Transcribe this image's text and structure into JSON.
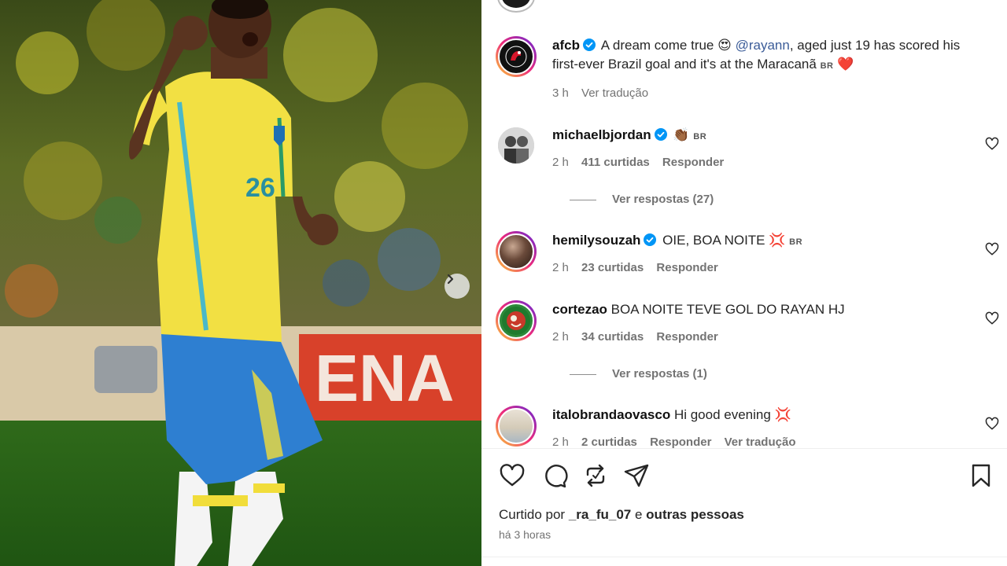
{
  "post": {
    "author": "afcb",
    "caption_intro": "A dream come true",
    "caption_emoji": "😍",
    "mention": "@rayann",
    "caption_rest": ", aged just 19 has scored his first-ever Brazil goal and it's at the Maracanã",
    "flag": "BR",
    "heart": "❤️",
    "age": "3 h",
    "translate": "Ver tradução"
  },
  "comments": [
    {
      "user": "michaelbjordan",
      "verified": true,
      "text": "",
      "emoji": "👏🏾",
      "flag": "BR",
      "age": "2 h",
      "likes": "411 curtidas",
      "reply": "Responder",
      "view_replies": "Ver respostas (27)"
    },
    {
      "user": "hemilysouzah",
      "verified": true,
      "text": "OIE, BOA NOITE",
      "emoji": "💢",
      "flag": "BR",
      "age": "2 h",
      "likes": "23 curtidas",
      "reply": "Responder"
    },
    {
      "user": "cortezao",
      "verified": false,
      "text": "BOA NOITE TEVE GOL DO RAYAN HJ",
      "age": "2 h",
      "likes": "34 curtidas",
      "reply": "Responder",
      "view_replies": "Ver respostas (1)"
    },
    {
      "user": "italobrandaovasco",
      "verified": false,
      "text": "Hi good evening",
      "emoji": "💢",
      "age": "2 h",
      "likes": "2 curtidas",
      "reply": "Responder",
      "translate": "Ver tradução"
    }
  ],
  "liked_by": {
    "prefix": "Curtido por",
    "user": "_ra_fu_07",
    "joiner": "e",
    "others": "outras pessoas"
  },
  "timestamp": "há 3 horas",
  "icons": [
    "heart-icon",
    "comment-icon",
    "repost-icon",
    "share-icon",
    "bookmark-icon",
    "chevron-right-icon",
    "verified-badge-icon"
  ],
  "colors": {
    "verified": "#0095f6",
    "heart": "#ed4956",
    "jersey": "#f2e043",
    "shorts": "#2e7fd1"
  },
  "media": {
    "jersey_number": "26"
  }
}
